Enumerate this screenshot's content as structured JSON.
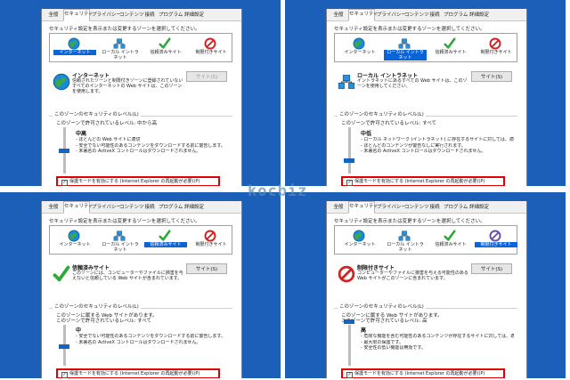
{
  "tabs": [
    "全般",
    "セキュリティ",
    "プライバシー",
    "コンテンツ",
    "接続",
    "プログラム",
    "詳細設定"
  ],
  "instruction": "セキュリティ設定を表示または変更するゾーンを選択してください。",
  "zones": [
    "インターネット",
    "ローカル イントラネット",
    "信頼済みサイト",
    "制限付きサイト"
  ],
  "sites_button": "サイト(S)",
  "level_group_title": "このゾーンのセキュリティのレベル(L)",
  "protected_mode": "保護モードを有効にする (Internet Explorer の再起動が必要)(P)",
  "watermark": "kocbiz",
  "colors": {
    "background": "#1c5fb8",
    "highlight": "#e00000",
    "selected": "#0a64d8"
  },
  "panels": [
    {
      "selected_zone": 0,
      "zone_title": "インターネット",
      "zone_icon": "globe-icon",
      "zone_desc": "信頼されたゾーンと制限付きゾーンに登録されていないすべてのインターネットの Web サイトは、このゾーンを使用します。",
      "allow_label": "このゾーンで許可されているレベル: 中から高",
      "level_name": "中高",
      "level_fraction": 0.5,
      "bullets": [
        "- ほとんどの Web サイトに適切",
        "- 安全でない可能性のあるコンテンツをダウンロードする前に警告します。",
        "- 未署名の ActiveX コントロールはダウンロードされません。"
      ]
    },
    {
      "selected_zone": 1,
      "zone_title": "ローカル イントラネット",
      "zone_icon": "intranet-icon",
      "zone_desc": "イントラネットにあるすべての Web サイトは、このゾーンを使用してください。",
      "allow_label": "このゾーンで許可されているレベル: すべて",
      "level_name": "中低",
      "level_fraction": 0.25,
      "bullets": [
        "- ローカル ネットワーク (イントラネット) に存在するサイトに対しては、適切です。",
        "- ほとんどのコンテンツが警告なしに実行されます。",
        "- 未署名の ActiveX コントロールはダウンロードされません。"
      ]
    },
    {
      "selected_zone": 2,
      "zone_title": "信頼済みサイト",
      "zone_icon": "check-icon",
      "zone_desc": "このゾーンには、コンピューターやファイルに損害を与えないと信頼している Web サイトが含まれています。",
      "allow_label": "このゾーンに属する Web サイトがあります。",
      "allow_label2": "このゾーンで許可されているレベル: すべて",
      "level_name": "中",
      "level_fraction": 0.4,
      "bullets": [
        "- 安全でない可能性のあるコンテンツをダウンロードする前に警告します。",
        "- 未署名の ActiveX コントロールはダウンロードされません。"
      ]
    },
    {
      "selected_zone": 3,
      "zone_title": "制限付きサイト",
      "zone_icon": "restricted-icon",
      "zone_desc": "コンピューターやファイルに損害を与える可能性のある Web サイトがこのゾーンに含まれています。",
      "allow_label": "このゾーンに属する Web サイトがあります。",
      "allow_label2": "このゾーンで許可されているレベル: 高",
      "level_name": "高",
      "level_fraction": 1.0,
      "bullets": [
        "- 危険な機能を含む可能性のあるコンテンツが存在するサイトに対しては、適切です。",
        "- 最大限の保護です。",
        "- 安全性の低い機能は無効です。"
      ]
    }
  ]
}
